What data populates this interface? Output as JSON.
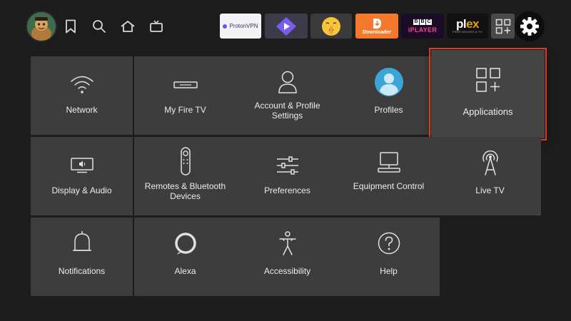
{
  "topbar": {
    "apps": {
      "protonvpn": "ProtonVPN",
      "downloader": "Downloader",
      "iplayer_bbc": [
        "B",
        "B",
        "C"
      ],
      "iplayer": "iPLAYER",
      "plex_pl": "pl",
      "plex_ex": "ex",
      "plex_sub": "FREE MOVIES & TV"
    },
    "icons": [
      "bookmark-icon",
      "search-icon",
      "home-icon",
      "live-tv-icon",
      "gear-icon",
      "add-apps-icon"
    ]
  },
  "tiles": {
    "network": "Network",
    "my_fire_tv": "My Fire TV",
    "account_profile": "Account & Profile Settings",
    "profiles": "Profiles",
    "applications": "Applications",
    "display_audio": "Display & Audio",
    "remotes_bluetooth": "Remotes & Bluetooth Devices",
    "preferences": "Preferences",
    "equipment_control": "Equipment Control",
    "live_tv": "Live TV",
    "notifications": "Notifications",
    "alexa": "Alexa",
    "accessibility": "Accessibility",
    "help": "Help"
  },
  "colors": {
    "focus_outline": "#e03a1e",
    "tile": "#3d3d3d",
    "background": "#1c1c1c"
  }
}
